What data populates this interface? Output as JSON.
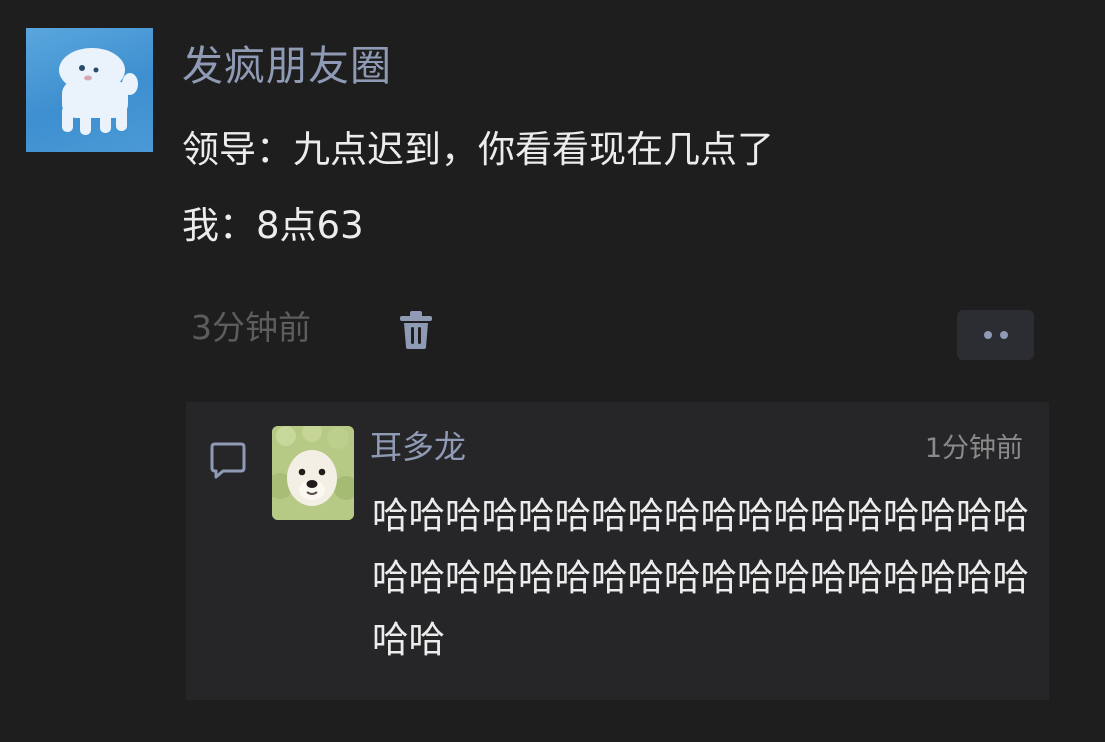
{
  "post": {
    "username": "发疯朋友圈",
    "lines": [
      "领导：九点迟到，你看看现在几点了",
      "我：8点63"
    ],
    "timestamp": "3分钟前",
    "avatar_icon": "white-dog-on-blue-avatar",
    "delete_icon": "trash-icon",
    "more_icon": "more-dots-icon"
  },
  "comment": {
    "icon": "comment-bubble-icon",
    "avatar_icon": "dog-in-green-hood-avatar",
    "author": "耳多龙",
    "time": "1分钟前",
    "text": "哈哈哈哈哈哈哈哈哈哈哈哈哈哈哈哈哈哈哈哈哈哈哈哈哈哈哈哈哈哈哈哈哈哈哈哈哈哈"
  },
  "colors": {
    "background": "#1e1e1e",
    "name": "#8f9bb5",
    "comment_panel": "#262629"
  }
}
